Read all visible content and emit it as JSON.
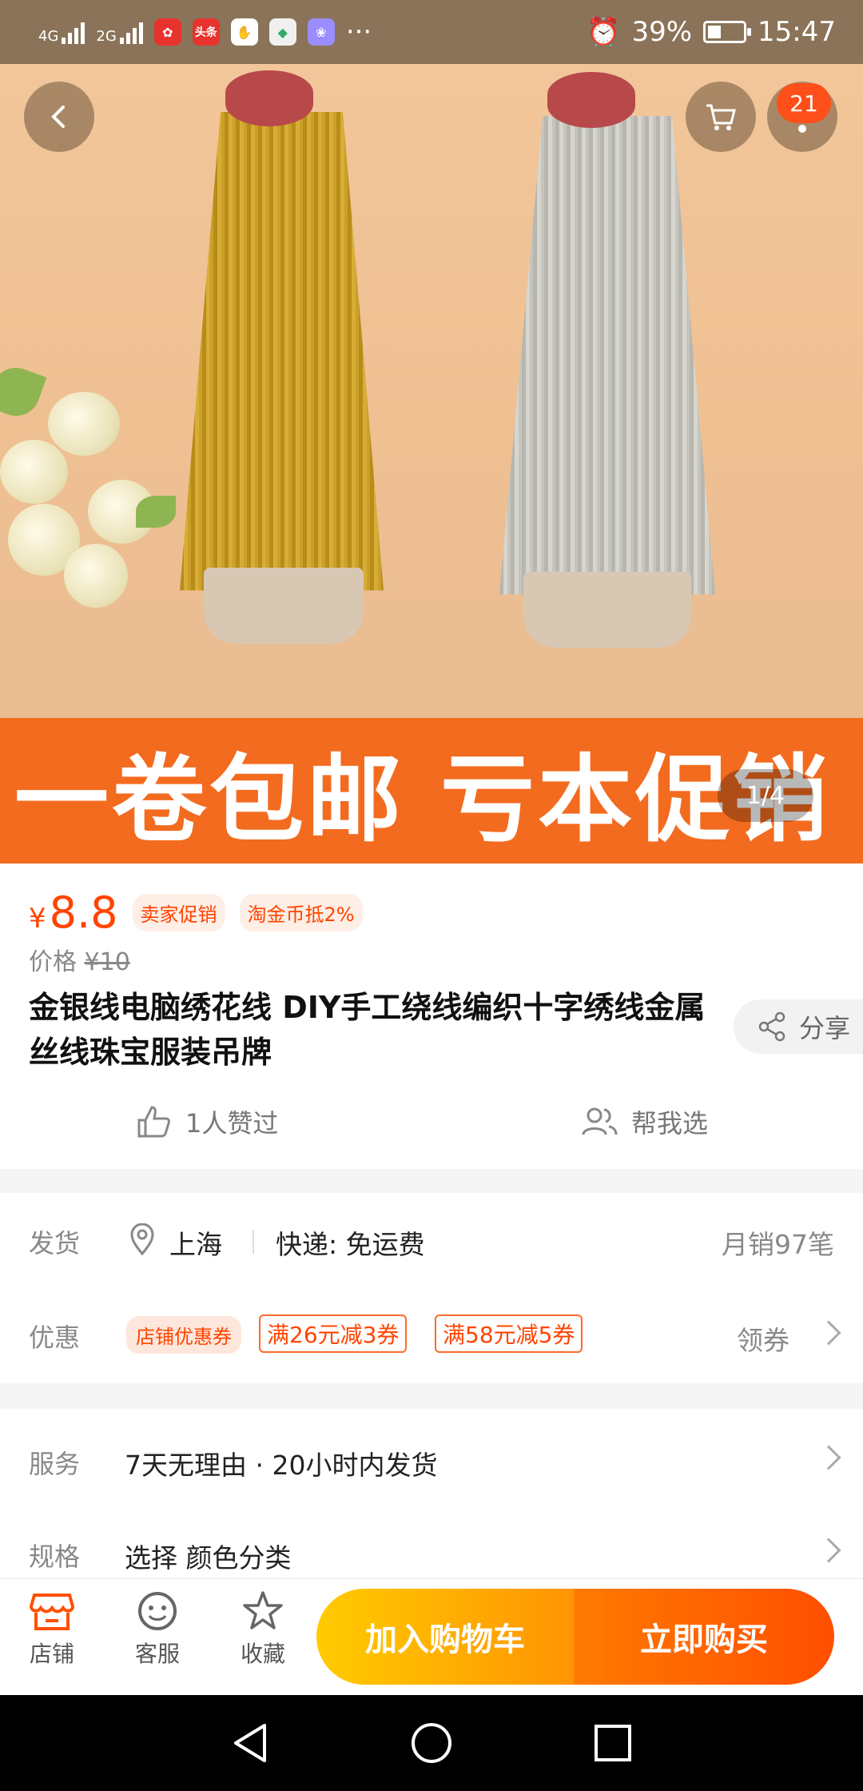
{
  "status_bar": {
    "network1": "4G",
    "network2": "2G",
    "battery": "39%",
    "time": "15:47",
    "more": "···",
    "app_icon_2": "头条"
  },
  "hero": {
    "promo_text": "一卷包邮 亏本促销",
    "counter": "1/4",
    "cart_badge": "21"
  },
  "product": {
    "currency": "¥",
    "price": "8.8",
    "tags": [
      "卖家促销",
      "淘金币抵2%"
    ],
    "original_label": "价格",
    "original_price": "¥10",
    "title": "金银线电脑绣花线 DIY手工绕线编织十字绣线金属丝线珠宝服装吊牌",
    "share_label": "分享",
    "likes": "1人赞过",
    "help_choose": "帮我选"
  },
  "shipping": {
    "label": "发货",
    "location": "上海",
    "delivery": "快递: 免运费",
    "monthly_sales": "月销97笔"
  },
  "offers": {
    "label": "优惠",
    "store_coupon": "店铺优惠券",
    "coupon1": "满26元减3券",
    "coupon2": "满58元减5券",
    "claim": "领券"
  },
  "service": {
    "label": "服务",
    "value": "7天无理由 · 20小时内发货"
  },
  "spec": {
    "label": "规格",
    "value": "选择 颜色分类"
  },
  "bottom": {
    "store": "店铺",
    "service": "客服",
    "favorite": "收藏",
    "add_to_cart": "加入购物车",
    "buy_now": "立即购买"
  },
  "colors": {
    "accent": "#ff4400",
    "status_bar": "#8a7358",
    "promo_banner": "#f36b1f"
  }
}
